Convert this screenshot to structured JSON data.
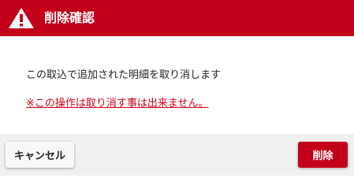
{
  "dialog": {
    "title": "削除確認",
    "icon": "warning-triangle-icon",
    "message": "この取込で追加された明細を取り消します",
    "warning_note": "※この操作は取り消す事は出来ません。",
    "buttons": {
      "cancel_label": "キャンセル",
      "delete_label": "削除"
    }
  },
  "colors": {
    "accent": "#c3001a",
    "warning_text": "#d0021b",
    "footer_bg": "#f0f0f0"
  }
}
